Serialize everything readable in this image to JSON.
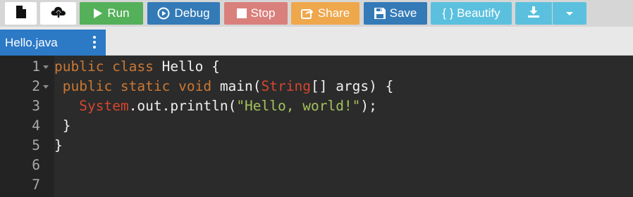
{
  "toolbar": {
    "buttons": [
      {
        "icon": "file-icon",
        "label": ""
      },
      {
        "icon": "cloud-upload-icon",
        "label": ""
      },
      {
        "icon": "play-icon",
        "label": "Run"
      },
      {
        "icon": "debug-circle-play-icon",
        "label": "Debug"
      },
      {
        "icon": "stop-square-icon",
        "label": "Stop"
      },
      {
        "icon": "share-icon",
        "label": "Share"
      },
      {
        "icon": "floppy-disk-icon",
        "label": "Save"
      },
      {
        "icon": "",
        "label": "{ } Beautify"
      },
      {
        "icon": "download-icon",
        "label": ""
      },
      {
        "icon": "caret-down-icon",
        "label": ""
      }
    ],
    "colors": {
      "run": "#55b05a",
      "debug": "#337ab7",
      "stop": "#d9807d",
      "share": "#efa74c",
      "save": "#337ab7",
      "beautify": "#5bc0de"
    }
  },
  "tab": {
    "filename": "Hello.java",
    "menu_icon": "kebab-menu-icon"
  },
  "editor": {
    "language": "java",
    "line_numbers": [
      "1",
      "2",
      "3",
      "4",
      "5",
      "6",
      "7"
    ],
    "lines": [
      [
        {
          "t": "kw",
          "v": "public class "
        },
        {
          "t": "pl",
          "v": "Hello {"
        }
      ],
      [
        {
          "t": "pl",
          "v": " "
        },
        {
          "t": "kw",
          "v": "public static void "
        },
        {
          "t": "pl",
          "v": "main("
        },
        {
          "t": "ty",
          "v": "String"
        },
        {
          "t": "pl",
          "v": "[] args) {"
        }
      ],
      [
        {
          "t": "pl",
          "v": "   "
        },
        {
          "t": "ty",
          "v": "System"
        },
        {
          "t": "pl",
          "v": ".out.println("
        },
        {
          "t": "str",
          "v": "\"Hello, world!\""
        },
        {
          "t": "pl",
          "v": ");"
        }
      ],
      [
        {
          "t": "pl",
          "v": " }"
        }
      ],
      [
        {
          "t": "pl",
          "v": "}"
        }
      ],
      [],
      []
    ],
    "colors": {
      "keyword": "#cc7832",
      "plain": "#f0f0f0",
      "type": "#d4462f",
      "string": "#a5c25c",
      "background": "#2b2b2b",
      "gutter": "#232323"
    }
  }
}
